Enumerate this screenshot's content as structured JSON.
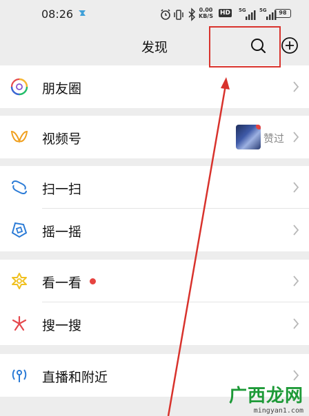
{
  "status_bar": {
    "time": "08:26",
    "speed_value": "0.00",
    "speed_unit": "KB/S",
    "hd_badge": "HD",
    "net1": "5G",
    "net2": "5G",
    "battery": "98"
  },
  "header": {
    "title": "发现",
    "search_icon": "search-icon",
    "add_icon": "add-circle-icon"
  },
  "menu": [
    {
      "label": "朋友圈",
      "icon": "moments-icon"
    },
    {
      "label": "视频号",
      "icon": "channels-icon",
      "extra_text": "赞过"
    },
    {
      "label": "扫一扫",
      "icon": "scan-icon"
    },
    {
      "label": "摇一摇",
      "icon": "shake-icon"
    },
    {
      "label": "看一看",
      "icon": "top-stories-icon"
    },
    {
      "label": "搜一搜",
      "icon": "search-discover-icon"
    },
    {
      "label": "直播和附近",
      "icon": "live-nearby-icon"
    }
  ],
  "annotation": {
    "color": "#d8322c"
  },
  "watermark": {
    "name": "广西龙网",
    "url": "mingyan1.com"
  },
  "colors": {
    "background": "#ededed",
    "badge": "#e64340",
    "secondary_text": "#8a8a8a"
  }
}
